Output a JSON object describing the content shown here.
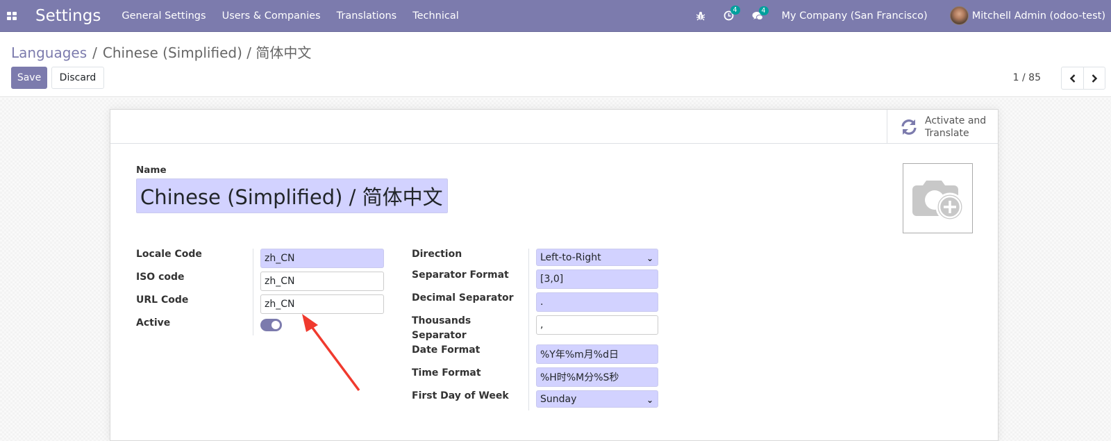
{
  "navbar": {
    "app_title": "Settings",
    "menu": [
      "General Settings",
      "Users & Companies",
      "Translations",
      "Technical"
    ],
    "activity_badge": "4",
    "messages_badge": "4",
    "company": "My Company (San Francisco)",
    "user": "Mitchell Admin (odoo-test)",
    "icons": [
      "apps-icon",
      "bug-icon",
      "clock-icon",
      "chat-icon"
    ]
  },
  "control_panel": {
    "breadcrumb": {
      "parent": "Languages",
      "current": "Chinese (Simplified) / 简体中文",
      "separator": "/"
    },
    "save_label": "Save",
    "discard_label": "Discard",
    "pager": "1 / 85"
  },
  "sheet": {
    "smart_button": {
      "line1": "Activate and",
      "line2": "Translate"
    },
    "name_label": "Name",
    "name_value": "Chinese (Simplified) / 简体中文",
    "left_fields": [
      {
        "label": "Locale Code",
        "value": "zh_CN",
        "required": true
      },
      {
        "label": "ISO code",
        "value": "zh_CN",
        "required": false
      },
      {
        "label": "URL Code",
        "value": "zh_CN",
        "required": false
      },
      {
        "label": "Active",
        "value": "true",
        "type": "toggle"
      }
    ],
    "right_fields": [
      {
        "label": "Direction",
        "value": "Left-to-Right",
        "type": "select"
      },
      {
        "label": "Separator Format",
        "value": "[3,0]"
      },
      {
        "label": "Decimal Separator",
        "value": "."
      },
      {
        "label": "Thousands Separator",
        "value": ","
      },
      {
        "label": "Date Format",
        "value": "%Y年%m月%d日"
      },
      {
        "label": "Time Format",
        "value": "%H时%M分%S秒"
      },
      {
        "label": "First Day of Week",
        "value": "Sunday",
        "type": "select"
      }
    ]
  },
  "colors": {
    "brand": "#7c7bad",
    "required_field": "#d2d2ff",
    "badge": "#00a09d",
    "annotation_arrow": "#f03a2e"
  }
}
